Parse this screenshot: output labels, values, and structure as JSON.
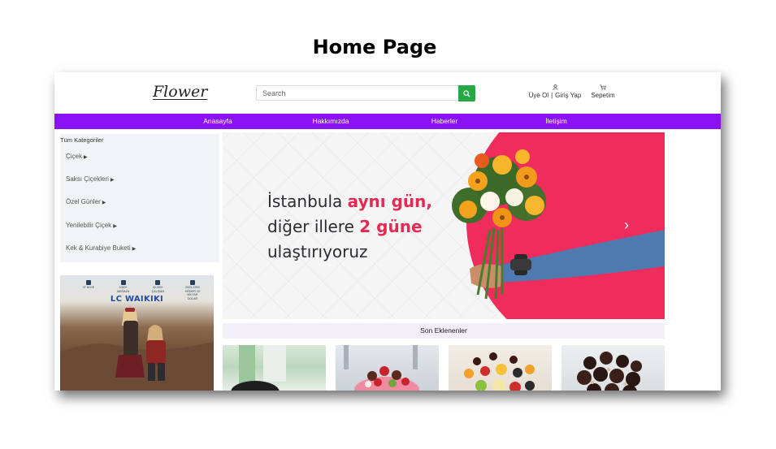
{
  "slide": {
    "title": "Home Page"
  },
  "header": {
    "logo": "Flower",
    "search": {
      "placeholder": "Search",
      "value": ""
    },
    "account": {
      "register": "Üye Ol",
      "login": "Giriş Yap"
    },
    "cart": {
      "label": "Sepetim"
    }
  },
  "nav": {
    "items": [
      {
        "label": "Anasayfa"
      },
      {
        "label": "Hakkımızda"
      },
      {
        "label": "Haberler"
      },
      {
        "label": "İletişim"
      }
    ]
  },
  "sidebar": {
    "heading": "Tüm Kategoriler",
    "items": [
      {
        "label": "Çiçek"
      },
      {
        "label": "Saksı Çiçekleri"
      },
      {
        "label": "Özel Günler"
      },
      {
        "label": "Yenilebilir Çiçek"
      },
      {
        "label": "Kek & Kurabiye Buketi"
      }
    ]
  },
  "ad": {
    "brand": "LC WAIKIKI",
    "stats": [
      {
        "text": "47 ÜLKE"
      },
      {
        "text": "1000+ MAĞAZA"
      },
      {
        "text": "40.000+ ÇALIŞAN"
      },
      {
        "text": "2025 CİRO HEDEFİ 10 MİLYAR DOLAR"
      }
    ]
  },
  "hero": {
    "line1_plain": "İstanbula ",
    "line1_accent": "aynı gün,",
    "line2_plain": "diğer illere ",
    "line2_accent": "2 güne",
    "line3": "ulaştırıyoruz",
    "next_icon": "chevron-right-icon"
  },
  "section": {
    "title": "Son Eklenenler"
  },
  "products": [
    {
      "image": "black-chair-photo"
    },
    {
      "image": "chocolate-strawberry-arrangement"
    },
    {
      "image": "fruit-bouquet"
    },
    {
      "image": "chocolate-truffle-bouquet"
    }
  ],
  "colors": {
    "nav": "#8a12f5",
    "search_button": "#28a745",
    "hero_accent": "#e42a52",
    "hero_circle": "#ef2c5c",
    "ad_brand": "#1e4ea0"
  }
}
